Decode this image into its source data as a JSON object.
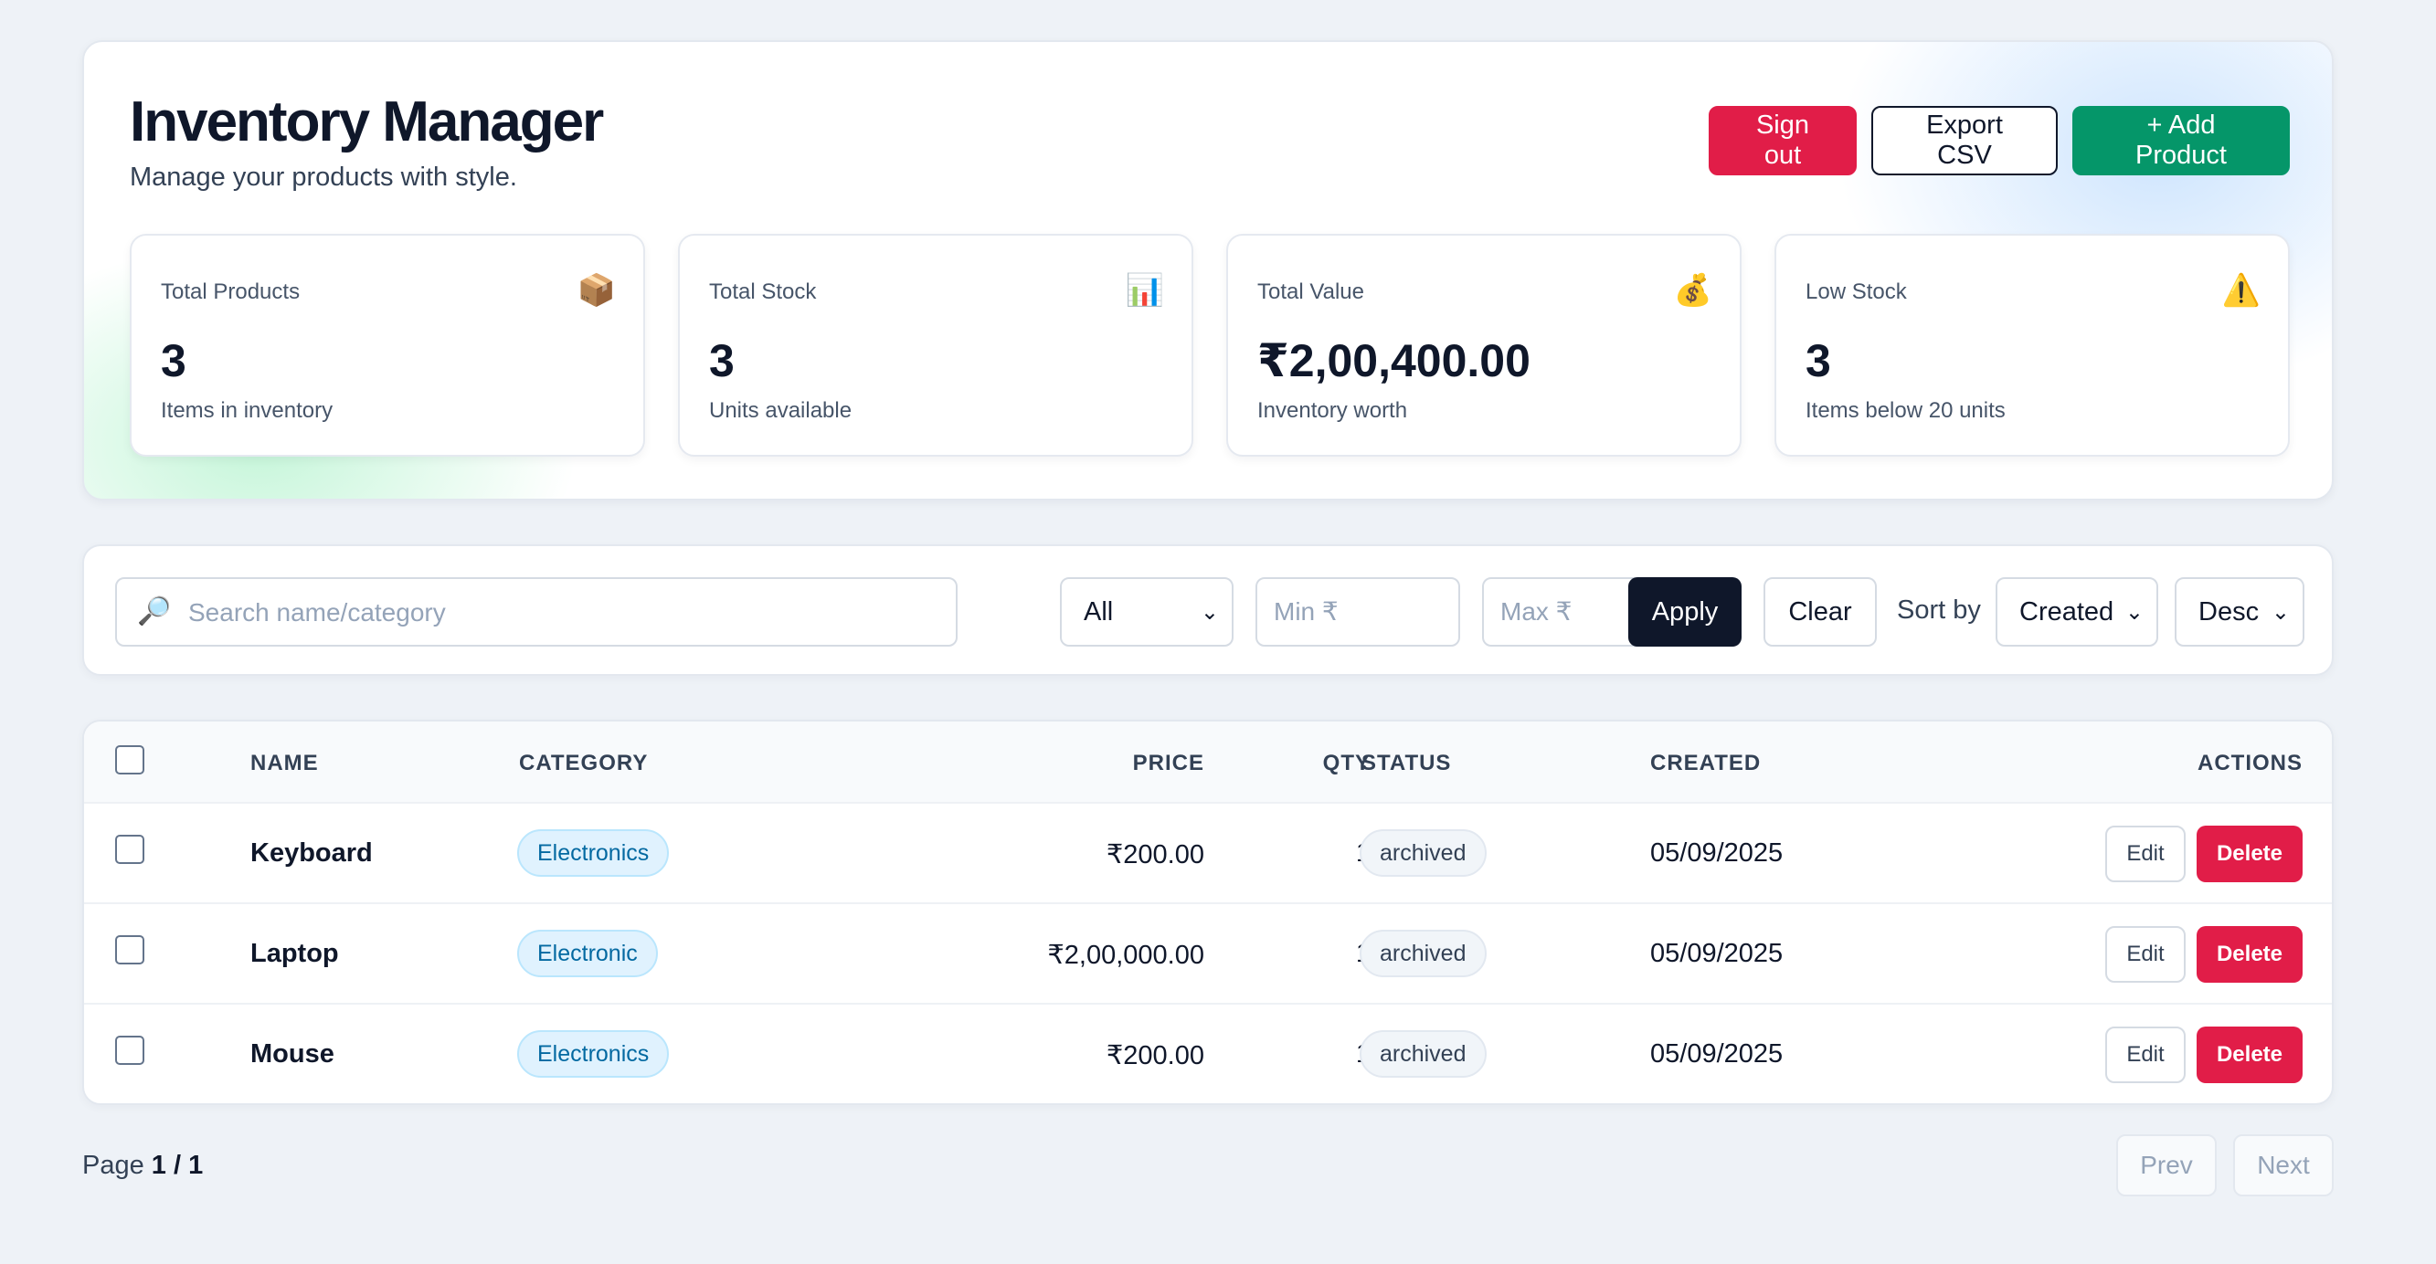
{
  "header": {
    "title": "Inventory Manager",
    "subtitle": "Manage your products with style.",
    "signout_label": "Sign out",
    "export_label": "Export CSV",
    "add_label": "+ Add Product"
  },
  "stats": [
    {
      "label": "Total Products",
      "icon": "package-icon",
      "glyph": "📦",
      "value": "3",
      "note": "Items in inventory"
    },
    {
      "label": "Total Stock",
      "icon": "bar-chart-icon",
      "glyph": "📊",
      "value": "3",
      "note": "Units available"
    },
    {
      "label": "Total Value",
      "icon": "money-bag-icon",
      "glyph": "💰",
      "value": "₹2,00,400.00",
      "note": "Inventory worth"
    },
    {
      "label": "Low Stock",
      "icon": "warning-icon",
      "glyph": "⚠️",
      "value": "3",
      "note": "Items below 20 units"
    }
  ],
  "filters": {
    "search_placeholder": "Search name/category",
    "search_value": "",
    "search_icon_glyph": "🔎",
    "category_value": "All",
    "min_placeholder": "Min ₹",
    "max_placeholder": "Max ₹",
    "apply_label": "Apply",
    "clear_label": "Clear",
    "sort_label": "Sort by",
    "sort_field_value": "Created",
    "sort_order_value": "Desc"
  },
  "table": {
    "columns": [
      "NAME",
      "CATEGORY",
      "PRICE",
      "QTY",
      "STATUS",
      "CREATED",
      "ACTIONS"
    ],
    "rows": [
      {
        "name": "Keyboard",
        "category": "Electronics",
        "price": "₹200.00",
        "qty": "1",
        "status": "archived",
        "created": "05/09/2025"
      },
      {
        "name": "Laptop",
        "category": "Electronic",
        "price": "₹2,00,000.00",
        "qty": "1",
        "status": "archived",
        "created": "05/09/2025"
      },
      {
        "name": "Mouse",
        "category": "Electronics",
        "price": "₹200.00",
        "qty": "1",
        "status": "archived",
        "created": "05/09/2025"
      }
    ],
    "edit_label": "Edit",
    "delete_label": "Delete"
  },
  "pagination": {
    "page_label": "Page",
    "current": "1",
    "separator": "/",
    "total": "1",
    "prev_label": "Prev",
    "next_label": "Next"
  },
  "colors": {
    "danger": "#e11d48",
    "success": "#059669",
    "dark": "#0f172a"
  }
}
